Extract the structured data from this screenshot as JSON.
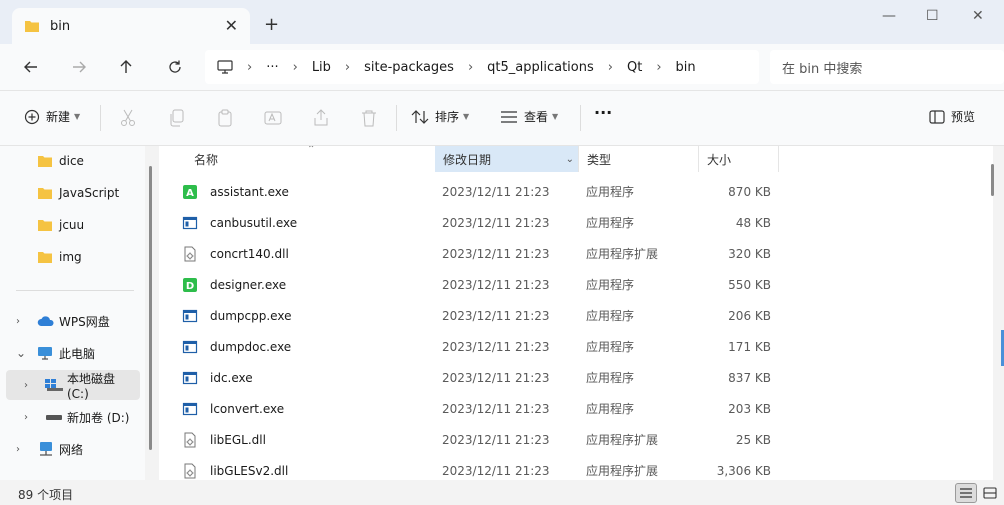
{
  "window": {
    "tab_title": "bin",
    "close_glyph": "✕",
    "new_tab_glyph": "+",
    "minimize_glyph": "—",
    "maximize_glyph": "☐",
    "close_window_glyph": "✕"
  },
  "address": {
    "ellipsis": "···",
    "crumbs": [
      "Lib",
      "site-packages",
      "qt5_applications",
      "Qt",
      "bin"
    ],
    "sep": "›",
    "search_placeholder": "在 bin 中搜索"
  },
  "toolbar": {
    "new_label": "新建",
    "sort_label": "排序",
    "view_label": "查看",
    "more_glyph": "···",
    "preview_label": "预览"
  },
  "sidebar": {
    "folders": [
      "dice",
      "JavaScript",
      "jcuu",
      "img"
    ],
    "wps_label": "WPS网盘",
    "pc_label": "此电脑",
    "c_drive_label": "本地磁盘 (C:)",
    "d_drive_label": "新加卷 (D:)",
    "network_label": "网络",
    "chev_right": "›",
    "chev_down": "⌄"
  },
  "columns": {
    "name": "名称",
    "date": "修改日期",
    "type": "类型",
    "size": "大小"
  },
  "files": [
    {
      "name": "assistant.exe",
      "date": "2023/12/11 21:23",
      "type": "应用程序",
      "size": "870 KB",
      "icon": "assistant-app-icon"
    },
    {
      "name": "canbusutil.exe",
      "date": "2023/12/11 21:23",
      "type": "应用程序",
      "size": "48 KB",
      "icon": "exe-icon"
    },
    {
      "name": "concrt140.dll",
      "date": "2023/12/11 21:23",
      "type": "应用程序扩展",
      "size": "320 KB",
      "icon": "dll-icon"
    },
    {
      "name": "designer.exe",
      "date": "2023/12/11 21:23",
      "type": "应用程序",
      "size": "550 KB",
      "icon": "designer-app-icon"
    },
    {
      "name": "dumpcpp.exe",
      "date": "2023/12/11 21:23",
      "type": "应用程序",
      "size": "206 KB",
      "icon": "exe-icon"
    },
    {
      "name": "dumpdoc.exe",
      "date": "2023/12/11 21:23",
      "type": "应用程序",
      "size": "171 KB",
      "icon": "exe-icon"
    },
    {
      "name": "idc.exe",
      "date": "2023/12/11 21:23",
      "type": "应用程序",
      "size": "837 KB",
      "icon": "exe-icon"
    },
    {
      "name": "lconvert.exe",
      "date": "2023/12/11 21:23",
      "type": "应用程序",
      "size": "203 KB",
      "icon": "exe-icon"
    },
    {
      "name": "libEGL.dll",
      "date": "2023/12/11 21:23",
      "type": "应用程序扩展",
      "size": "25 KB",
      "icon": "dll-icon"
    },
    {
      "name": "libGLESv2.dll",
      "date": "2023/12/11 21:23",
      "type": "应用程序扩展",
      "size": "3,306 KB",
      "icon": "dll-icon"
    }
  ],
  "status": {
    "count_text": "89 个项目"
  },
  "colors": {
    "folder": "#f5c342",
    "qt_green": "#2ebd4b",
    "exe_blue": "#1f5fa8",
    "sorted_header": "#d9e8f7"
  }
}
